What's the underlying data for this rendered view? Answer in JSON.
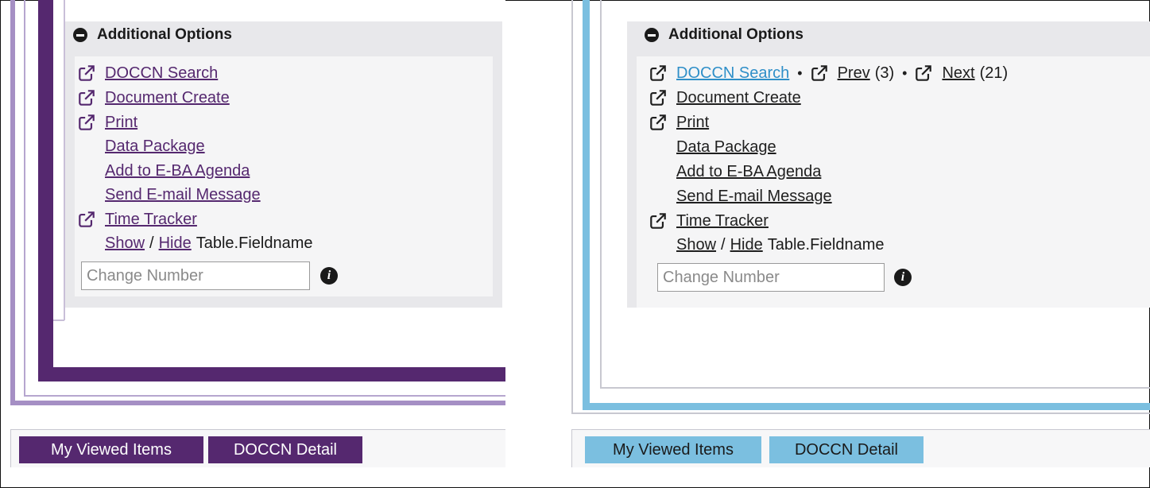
{
  "left": {
    "theme": {
      "accent": "#55286f",
      "accent_light": "#a58fc4",
      "link_color": "#55286f",
      "tab_text": "#ffffff"
    },
    "panel_title": "Additional Options",
    "doccn_search": "DOCCN Search",
    "document_create": "Document Create",
    "print": "Print",
    "data_package": "Data Package",
    "add_to_agenda": "Add to E-BA Agenda",
    "send_email": "Send E-mail Message",
    "time_tracker": "Time Tracker",
    "show": "Show",
    "slash": "/",
    "hide": "Hide",
    "table_fieldname": "Table.Fieldname",
    "change_number_placeholder": "Change Number",
    "tabs": [
      "My Viewed Items",
      "DOCCN Detail"
    ]
  },
  "right": {
    "theme": {
      "accent": "#7bbfe0",
      "link_color": "#1f1f1f",
      "search_link_color": "#2f8fc8",
      "tab_text": "#1a1a1a"
    },
    "panel_title": "Additional Options",
    "doccn_search": "DOCCN Search",
    "bullet": "•",
    "prev": "Prev",
    "prev_count": "(3)",
    "next": "Next",
    "next_count": "(21)",
    "document_create": "Document Create",
    "print": "Print",
    "data_package": "Data Package",
    "add_to_agenda": "Add to E-BA Agenda",
    "send_email": "Send E-mail Message",
    "time_tracker": "Time Tracker",
    "show": "Show",
    "slash": "/",
    "hide": "Hide",
    "table_fieldname": "Table.Fieldname",
    "change_number_placeholder": "Change Number",
    "tabs": [
      "My Viewed Items",
      "DOCCN Detail"
    ]
  },
  "icons": {
    "external": "external-link-icon",
    "collapse": "minus-circle-icon",
    "info": "info-circle-icon"
  }
}
